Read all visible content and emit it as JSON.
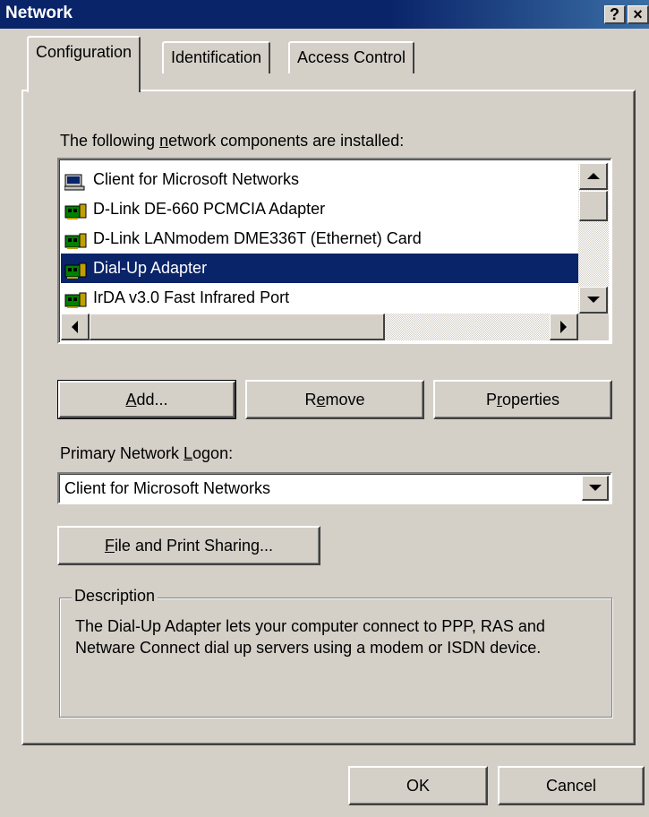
{
  "window": {
    "title": "Network",
    "help_label": "?",
    "close_label": "×"
  },
  "tabs": [
    {
      "label": "Configuration",
      "active": true
    },
    {
      "label": "Identification",
      "active": false
    },
    {
      "label": "Access Control",
      "active": false
    }
  ],
  "components": {
    "label_before": "The following ",
    "label_mnemonic": "n",
    "label_after": "etwork components are installed:",
    "items": [
      {
        "label": "Client for Microsoft Networks",
        "icon": "network-client-icon",
        "selected": false
      },
      {
        "label": "D-Link DE-660 PCMCIA Adapter",
        "icon": "network-adapter-icon",
        "selected": false
      },
      {
        "label": "D-Link LANmodem DME336T (Ethernet) Card",
        "icon": "network-adapter-icon",
        "selected": false
      },
      {
        "label": "Dial-Up Adapter",
        "icon": "network-adapter-icon",
        "selected": true
      },
      {
        "label": "IrDA v3.0 Fast Infrared Port",
        "icon": "network-adapter-icon",
        "selected": false
      }
    ]
  },
  "buttons": {
    "add": {
      "mnemonic": "A",
      "rest": "dd..."
    },
    "remove": {
      "before": "R",
      "mnemonic": "e",
      "rest": "move"
    },
    "properties": {
      "before": "P",
      "mnemonic": "r",
      "rest": "operties"
    },
    "file_print": {
      "mnemonic": "F",
      "rest": "ile and Print Sharing..."
    },
    "ok": "OK",
    "cancel": "Cancel"
  },
  "logon": {
    "label_before": "Primary Network ",
    "label_mnemonic": "L",
    "label_after": "ogon:",
    "value": "Client for Microsoft Networks"
  },
  "description": {
    "legend": "Description",
    "text": "The Dial-Up Adapter lets your computer connect to PPP, RAS and Netware Connect dial up servers using a modem or ISDN device."
  },
  "colors": {
    "face": "#d4d0c8",
    "titlebar": "#0a246a",
    "selection": "#0a246a",
    "window_bg": "#ffffff"
  }
}
